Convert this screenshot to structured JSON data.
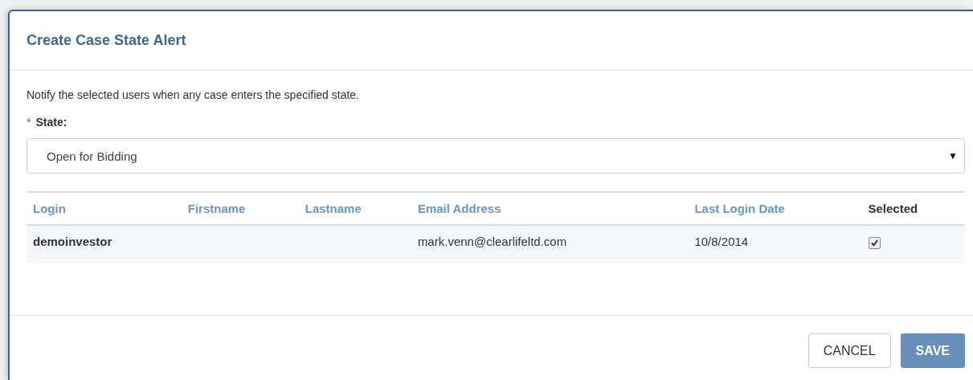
{
  "dialog": {
    "title": "Create Case State Alert"
  },
  "description": "Notify the selected users when any case enters the specified state.",
  "state_field": {
    "label": "State:",
    "required_mark": "*",
    "value": "Open for Bidding",
    "caret": "▼"
  },
  "table": {
    "columns": [
      {
        "label": "Login",
        "sortable": true
      },
      {
        "label": "Firstname",
        "sortable": true
      },
      {
        "label": "Lastname",
        "sortable": true
      },
      {
        "label": "Email Address",
        "sortable": true
      },
      {
        "label": "Last Login Date",
        "sortable": true
      },
      {
        "label": "Selected",
        "sortable": false
      }
    ],
    "rows": [
      {
        "login": "demoinvestor",
        "email": "mark.venn@clearlifeltd.com",
        "last_login": "10/8/2014",
        "checked": true
      }
    ]
  },
  "buttons": [
    {
      "label": "CANCEL",
      "kind": "secondary"
    },
    {
      "label": "SAVE",
      "kind": "primary"
    }
  ]
}
